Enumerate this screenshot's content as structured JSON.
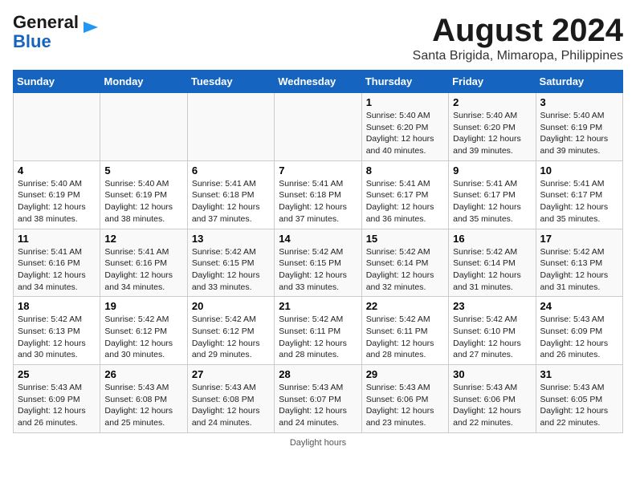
{
  "header": {
    "logo_line1": "General",
    "logo_line2": "Blue",
    "title": "August 2024",
    "subtitle": "Santa Brigida, Mimaropa, Philippines"
  },
  "days_of_week": [
    "Sunday",
    "Monday",
    "Tuesday",
    "Wednesday",
    "Thursday",
    "Friday",
    "Saturday"
  ],
  "weeks": [
    [
      {
        "day": "",
        "info": ""
      },
      {
        "day": "",
        "info": ""
      },
      {
        "day": "",
        "info": ""
      },
      {
        "day": "",
        "info": ""
      },
      {
        "day": "1",
        "info": "Sunrise: 5:40 AM\nSunset: 6:20 PM\nDaylight: 12 hours\nand 40 minutes."
      },
      {
        "day": "2",
        "info": "Sunrise: 5:40 AM\nSunset: 6:20 PM\nDaylight: 12 hours\nand 39 minutes."
      },
      {
        "day": "3",
        "info": "Sunrise: 5:40 AM\nSunset: 6:19 PM\nDaylight: 12 hours\nand 39 minutes."
      }
    ],
    [
      {
        "day": "4",
        "info": "Sunrise: 5:40 AM\nSunset: 6:19 PM\nDaylight: 12 hours\nand 38 minutes."
      },
      {
        "day": "5",
        "info": "Sunrise: 5:40 AM\nSunset: 6:19 PM\nDaylight: 12 hours\nand 38 minutes."
      },
      {
        "day": "6",
        "info": "Sunrise: 5:41 AM\nSunset: 6:18 PM\nDaylight: 12 hours\nand 37 minutes."
      },
      {
        "day": "7",
        "info": "Sunrise: 5:41 AM\nSunset: 6:18 PM\nDaylight: 12 hours\nand 37 minutes."
      },
      {
        "day": "8",
        "info": "Sunrise: 5:41 AM\nSunset: 6:17 PM\nDaylight: 12 hours\nand 36 minutes."
      },
      {
        "day": "9",
        "info": "Sunrise: 5:41 AM\nSunset: 6:17 PM\nDaylight: 12 hours\nand 35 minutes."
      },
      {
        "day": "10",
        "info": "Sunrise: 5:41 AM\nSunset: 6:17 PM\nDaylight: 12 hours\nand 35 minutes."
      }
    ],
    [
      {
        "day": "11",
        "info": "Sunrise: 5:41 AM\nSunset: 6:16 PM\nDaylight: 12 hours\nand 34 minutes."
      },
      {
        "day": "12",
        "info": "Sunrise: 5:41 AM\nSunset: 6:16 PM\nDaylight: 12 hours\nand 34 minutes."
      },
      {
        "day": "13",
        "info": "Sunrise: 5:42 AM\nSunset: 6:15 PM\nDaylight: 12 hours\nand 33 minutes."
      },
      {
        "day": "14",
        "info": "Sunrise: 5:42 AM\nSunset: 6:15 PM\nDaylight: 12 hours\nand 33 minutes."
      },
      {
        "day": "15",
        "info": "Sunrise: 5:42 AM\nSunset: 6:14 PM\nDaylight: 12 hours\nand 32 minutes."
      },
      {
        "day": "16",
        "info": "Sunrise: 5:42 AM\nSunset: 6:14 PM\nDaylight: 12 hours\nand 31 minutes."
      },
      {
        "day": "17",
        "info": "Sunrise: 5:42 AM\nSunset: 6:13 PM\nDaylight: 12 hours\nand 31 minutes."
      }
    ],
    [
      {
        "day": "18",
        "info": "Sunrise: 5:42 AM\nSunset: 6:13 PM\nDaylight: 12 hours\nand 30 minutes."
      },
      {
        "day": "19",
        "info": "Sunrise: 5:42 AM\nSunset: 6:12 PM\nDaylight: 12 hours\nand 30 minutes."
      },
      {
        "day": "20",
        "info": "Sunrise: 5:42 AM\nSunset: 6:12 PM\nDaylight: 12 hours\nand 29 minutes."
      },
      {
        "day": "21",
        "info": "Sunrise: 5:42 AM\nSunset: 6:11 PM\nDaylight: 12 hours\nand 28 minutes."
      },
      {
        "day": "22",
        "info": "Sunrise: 5:42 AM\nSunset: 6:11 PM\nDaylight: 12 hours\nand 28 minutes."
      },
      {
        "day": "23",
        "info": "Sunrise: 5:42 AM\nSunset: 6:10 PM\nDaylight: 12 hours\nand 27 minutes."
      },
      {
        "day": "24",
        "info": "Sunrise: 5:43 AM\nSunset: 6:09 PM\nDaylight: 12 hours\nand 26 minutes."
      }
    ],
    [
      {
        "day": "25",
        "info": "Sunrise: 5:43 AM\nSunset: 6:09 PM\nDaylight: 12 hours\nand 26 minutes."
      },
      {
        "day": "26",
        "info": "Sunrise: 5:43 AM\nSunset: 6:08 PM\nDaylight: 12 hours\nand 25 minutes."
      },
      {
        "day": "27",
        "info": "Sunrise: 5:43 AM\nSunset: 6:08 PM\nDaylight: 12 hours\nand 24 minutes."
      },
      {
        "day": "28",
        "info": "Sunrise: 5:43 AM\nSunset: 6:07 PM\nDaylight: 12 hours\nand 24 minutes."
      },
      {
        "day": "29",
        "info": "Sunrise: 5:43 AM\nSunset: 6:06 PM\nDaylight: 12 hours\nand 23 minutes."
      },
      {
        "day": "30",
        "info": "Sunrise: 5:43 AM\nSunset: 6:06 PM\nDaylight: 12 hours\nand 22 minutes."
      },
      {
        "day": "31",
        "info": "Sunrise: 5:43 AM\nSunset: 6:05 PM\nDaylight: 12 hours\nand 22 minutes."
      }
    ]
  ],
  "footer": {
    "daylight_label": "Daylight hours"
  }
}
